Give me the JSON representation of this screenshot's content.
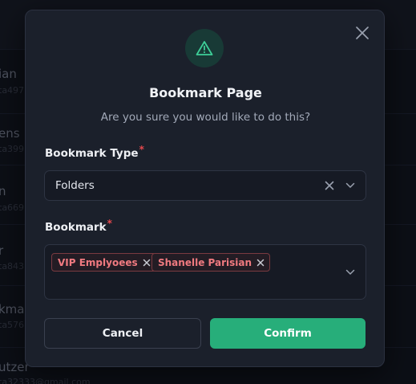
{
  "background": {
    "rows": [
      {
        "name": "ian",
        "sub": "ta497"
      },
      {
        "name": "ens",
        "sub": "ta399"
      },
      {
        "name": "n",
        "sub": "ta669"
      },
      {
        "name": "r",
        "sub": "ta843"
      },
      {
        "name": "kmar",
        "sub": "ta576"
      },
      {
        "name": "utzer",
        "sub": "ta32333@gmail.com"
      }
    ]
  },
  "modal": {
    "title": "Bookmark Page",
    "subtitle": "Are you sure you would like to do this?",
    "icon": "warning-triangle-icon",
    "accent_color": "#27ae7a",
    "fields": {
      "bookmark_type": {
        "label": "Bookmark Type",
        "required_mark": "*",
        "value": "Folders"
      },
      "bookmark": {
        "label": "Bookmark",
        "required_mark": "*",
        "tags": [
          "VIP Emplyoees",
          "Shanelle Parisian"
        ]
      }
    },
    "buttons": {
      "cancel": "Cancel",
      "confirm": "Confirm"
    }
  }
}
